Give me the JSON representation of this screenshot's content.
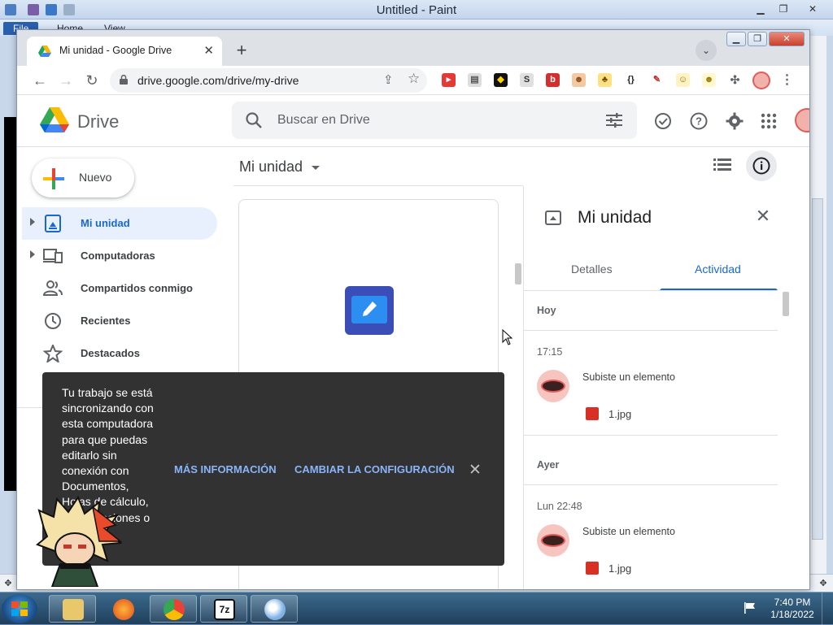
{
  "paint": {
    "title": "Untitled - Paint",
    "menu": [
      "File",
      "Home",
      "View"
    ]
  },
  "browser": {
    "tab_title": "Mi unidad - Google Drive",
    "url": "drive.google.com/drive/my-drive"
  },
  "drive": {
    "product_name": "Drive",
    "search_placeholder": "Buscar en Drive",
    "new_button": "Nuevo",
    "nav": [
      {
        "label": "Mi unidad"
      },
      {
        "label": "Computadoras"
      },
      {
        "label": "Compartidos conmigo"
      },
      {
        "label": "Recientes"
      },
      {
        "label": "Destacados"
      }
    ],
    "main_title": "Mi unidad"
  },
  "panel": {
    "title": "Mi unidad",
    "tab_details": "Detalles",
    "tab_activity": "Actividad",
    "groups": [
      {
        "day": "Hoy",
        "time": "17:15",
        "action": "Subiste un elemento",
        "file": "1.jpg"
      },
      {
        "day": "Ayer",
        "time": "Lun 22:48",
        "action": "Subiste un elemento",
        "file": "1.jpg"
      }
    ]
  },
  "toast": {
    "message": "Tu trabajo se está sincronizando con esta computadora para que puedas editarlo sin conexión con Documentos, Hojas de cálculo, Presentaciones o",
    "more_info": "MÁS INFORMACIÓN",
    "change_settings": "CAMBIAR LA CONFIGURACIÓN"
  },
  "taskbar": {
    "time": "7:40 PM",
    "date": "1/18/2022"
  },
  "colors": {
    "accent": "#1967d2",
    "toast_bg": "#323232",
    "toast_link": "#8ab4f8",
    "active_nav_bg": "#e8f0fe"
  }
}
